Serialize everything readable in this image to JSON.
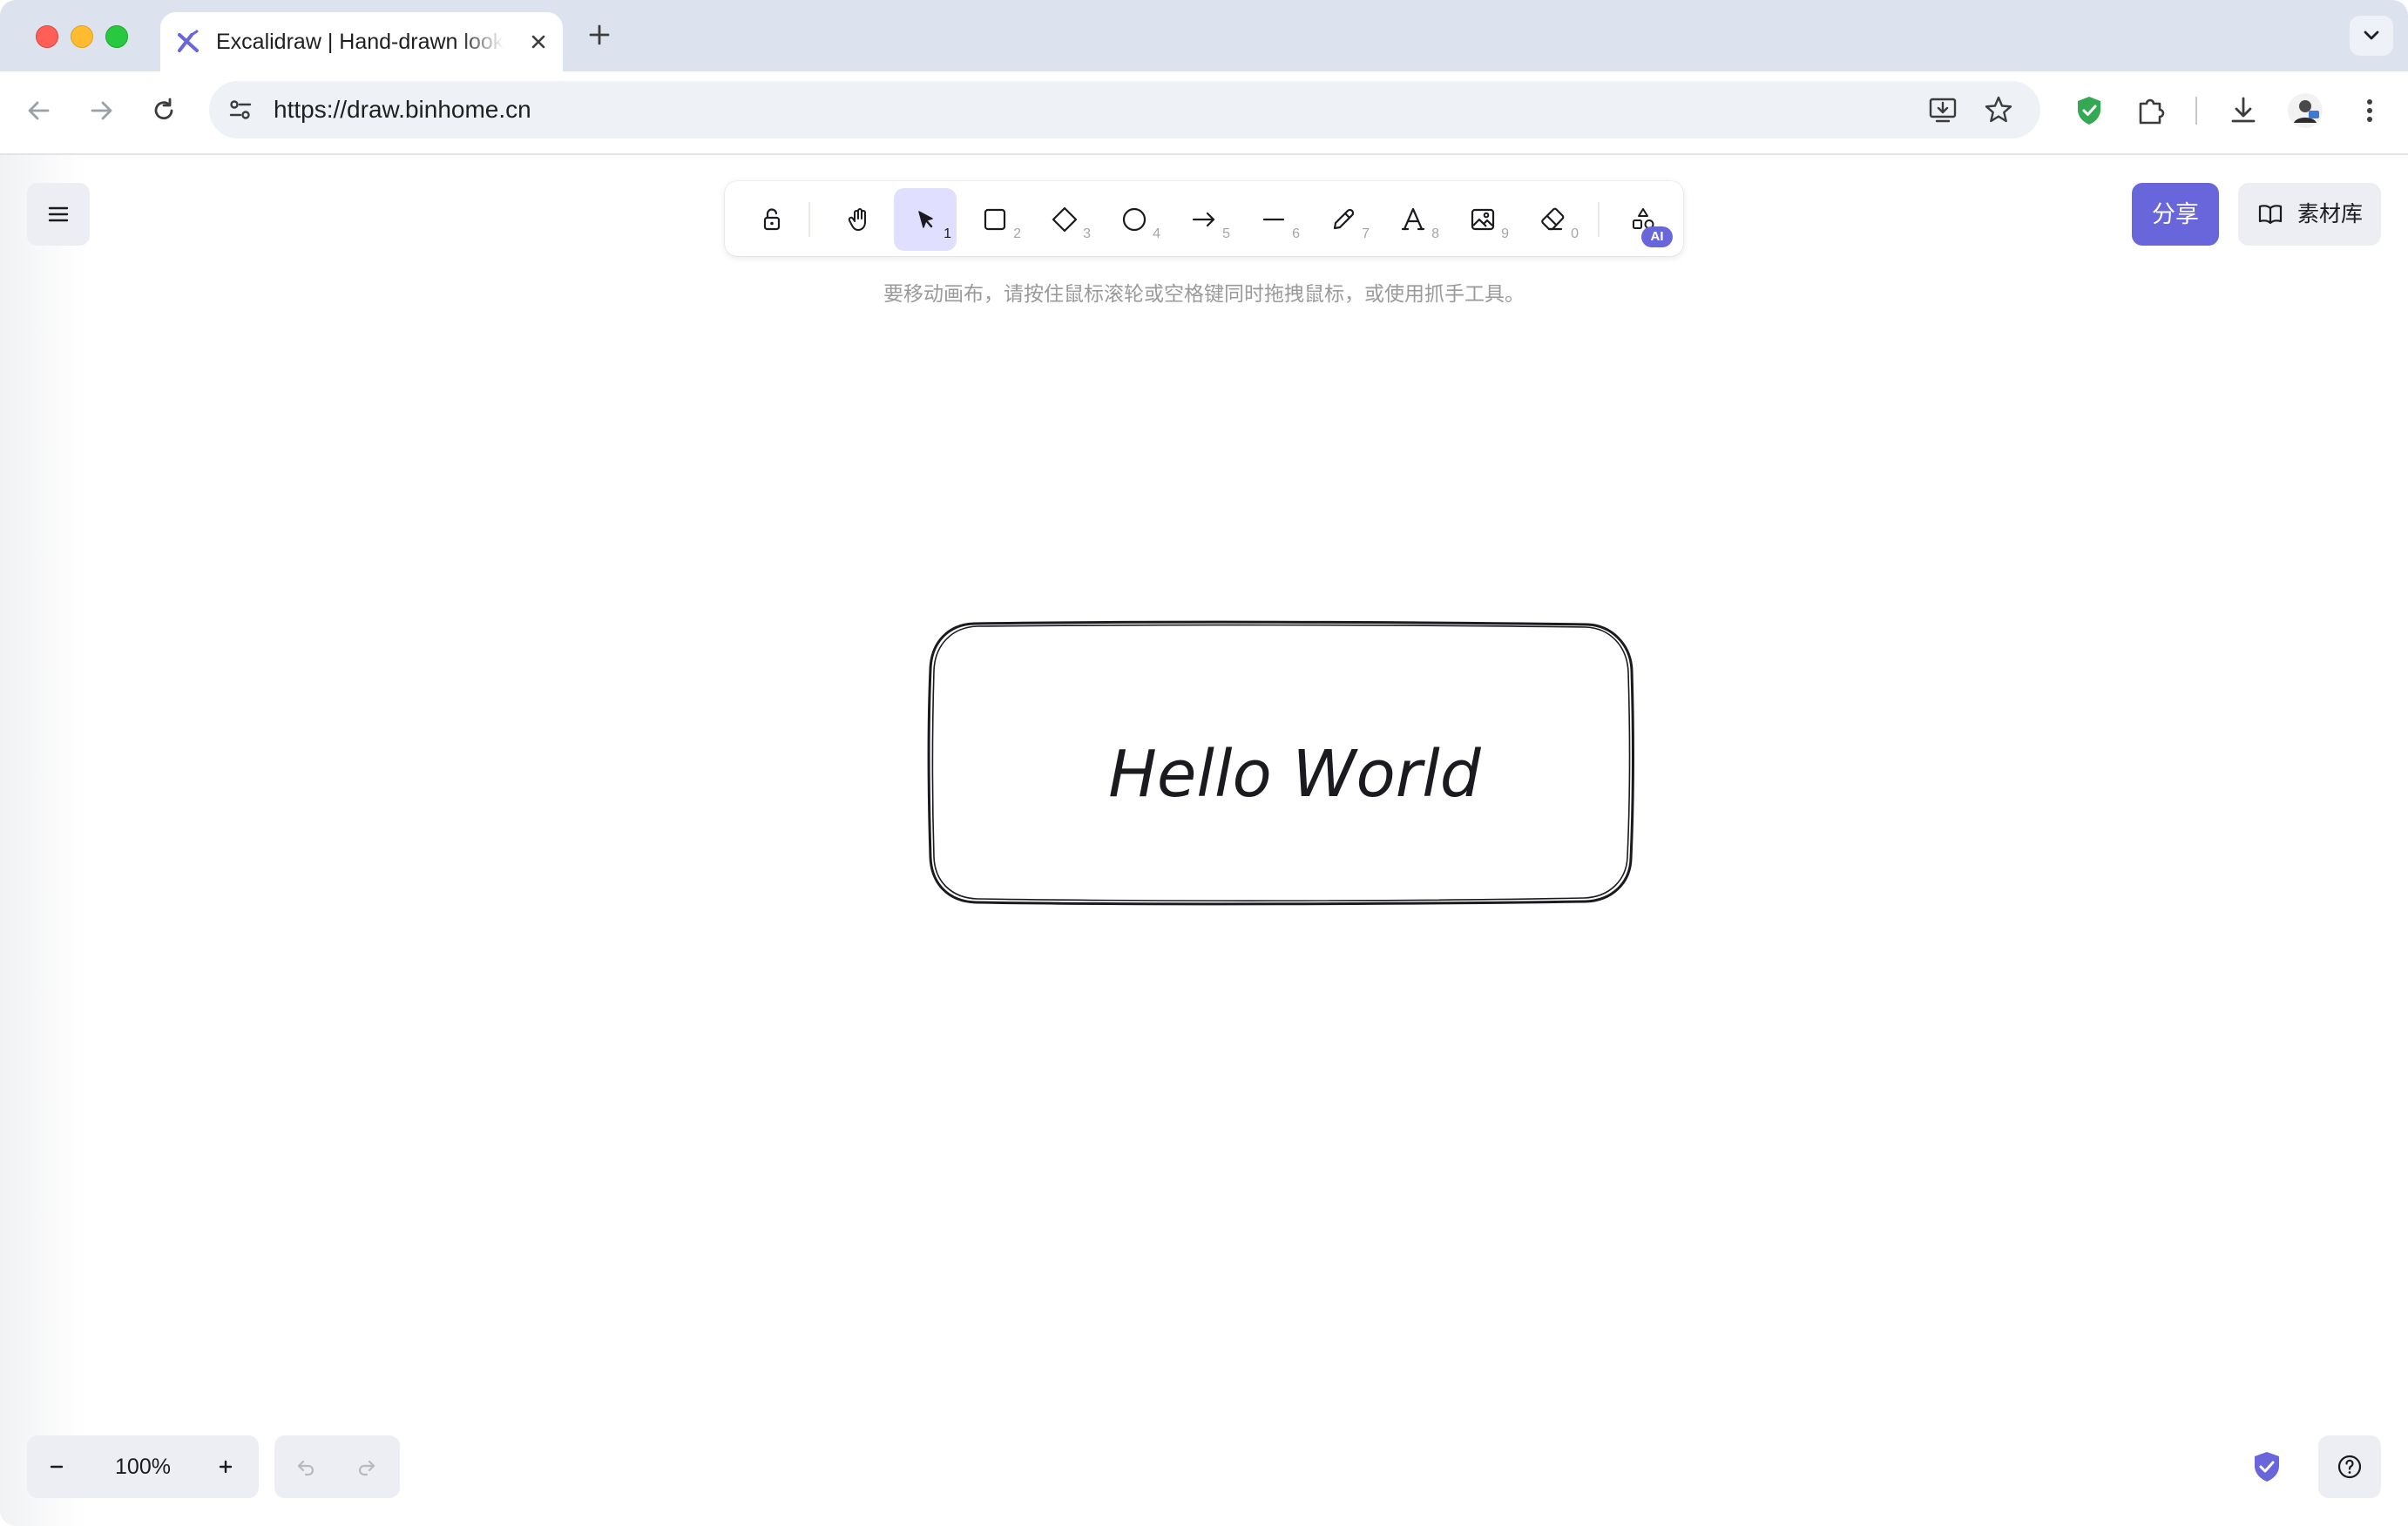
{
  "browser": {
    "tab": {
      "title": "Excalidraw | Hand-drawn look & feel • Collaborative"
    },
    "url": "https://draw.binhome.cn"
  },
  "app": {
    "toolbar": {
      "tools": [
        {
          "name": "lock",
          "key": ""
        },
        {
          "name": "hand",
          "key": ""
        },
        {
          "name": "selection",
          "key": "1"
        },
        {
          "name": "rectangle",
          "key": "2"
        },
        {
          "name": "diamond",
          "key": "3"
        },
        {
          "name": "ellipse",
          "key": "4"
        },
        {
          "name": "arrow",
          "key": "5"
        },
        {
          "name": "line",
          "key": "6"
        },
        {
          "name": "draw",
          "key": "7"
        },
        {
          "name": "text",
          "key": "8"
        },
        {
          "name": "image",
          "key": "9"
        },
        {
          "name": "eraser",
          "key": "0"
        },
        {
          "name": "more-tools",
          "key": ""
        }
      ],
      "active_tool": "selection",
      "ai_badge": "AI"
    },
    "hint": "要移动画布，请按住鼠标滚轮或空格键同时拖拽鼠标，或使用抓手工具。",
    "share_label": "分享",
    "library_label": "素材库",
    "zoom_level": "100%",
    "canvas_text": "Hello World",
    "accent_color": "#6965db"
  }
}
